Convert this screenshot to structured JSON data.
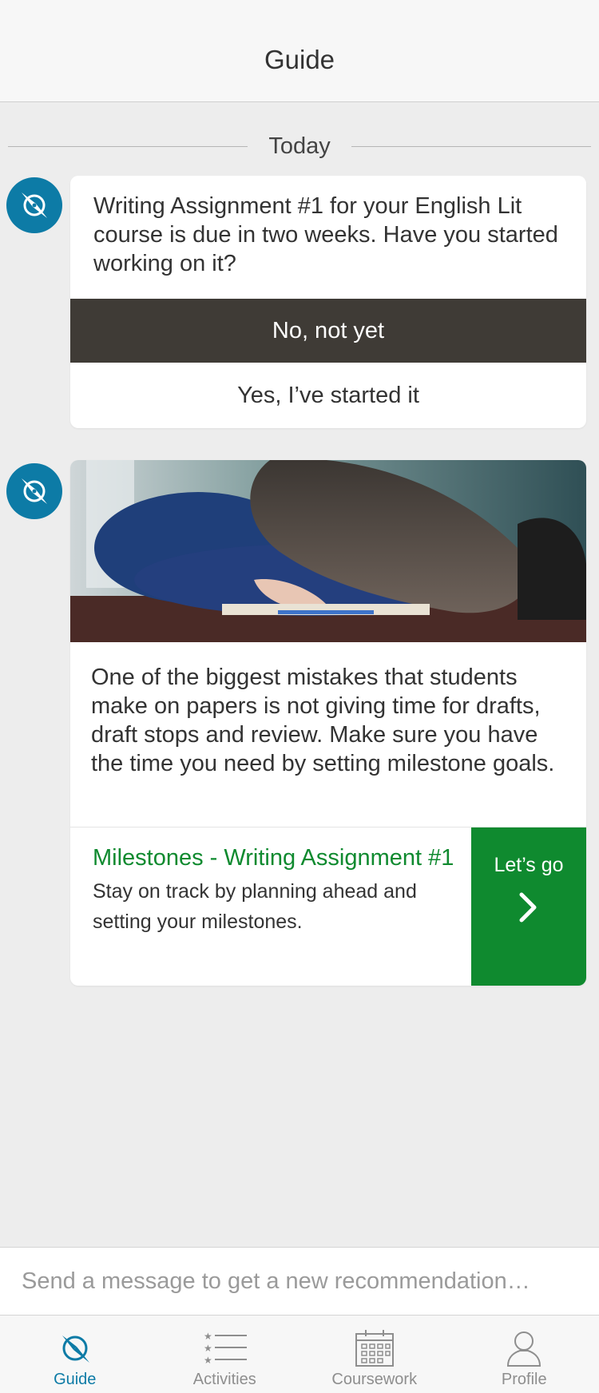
{
  "header": {
    "title": "Guide"
  },
  "feed": {
    "date_divider": "Today",
    "messages": [
      {
        "text": "Writing Assignment #1 for your English Lit course is due in two weeks. Have you started working on it?",
        "options": [
          "No, not yet",
          "Yes, I’ve started it"
        ]
      },
      {
        "text": "One of the biggest mistakes that students make on papers is not giving time for drafts, draft stops and review. Make sure you have the time you need by setting milestone goals.",
        "action": {
          "title": "Milestones - Writing Assignment #1",
          "description": "Stay on track by planning ahead and setting your milestones.",
          "button_label": "Let’s go"
        }
      }
    ]
  },
  "composer": {
    "placeholder": "Send a message to get a new recommendation…",
    "value": ""
  },
  "tabs": [
    {
      "label": "Guide",
      "icon": "compass-icon",
      "active": true
    },
    {
      "label": "Activities",
      "icon": "list-icon",
      "active": false
    },
    {
      "label": "Coursework",
      "icon": "calendar-icon",
      "active": false
    },
    {
      "label": "Profile",
      "icon": "person-icon",
      "active": false
    }
  ],
  "colors": {
    "accent": "#0d7ba6",
    "action_green": "#0f8a2f",
    "dark_option": "#3f3b36"
  }
}
